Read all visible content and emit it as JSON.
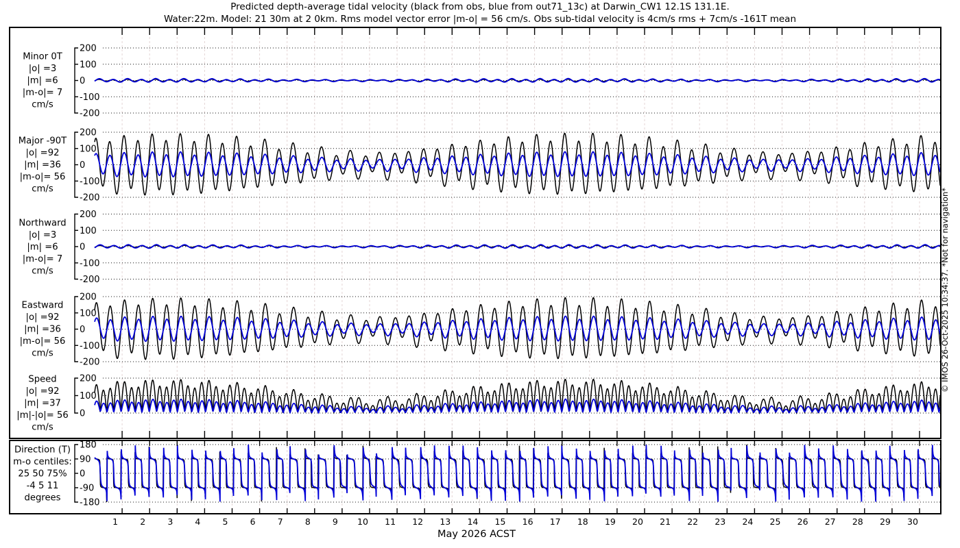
{
  "title": {
    "line1": "Predicted depth-average tidal velocity (black from obs, blue from out71_13c) at Darwin_CW1 12.1S 131.1E.",
    "line2": "Water:22m. Model: 21 30m at 2 0km. Rms model vector error |m-o| = 56 cm/s. Obs sub-tidal velocity is 4cm/s rms + 7cm/s -161T mean"
  },
  "watermark": "© IMOS 26-Oct-2025 10:34:37. *Not for navigation*",
  "chart_data": {
    "type": "line",
    "x_axis": {
      "label": "May 2026 ACST",
      "day_labels": [
        1,
        2,
        3,
        4,
        5,
        6,
        7,
        8,
        9,
        10,
        11,
        12,
        13,
        14,
        15,
        16,
        17,
        18,
        19,
        20,
        21,
        22,
        23,
        24,
        25,
        26,
        27,
        28,
        29,
        30
      ],
      "tick_days": [
        1,
        2,
        3,
        4,
        5,
        6,
        7,
        8,
        9,
        10,
        11,
        12,
        13,
        14,
        15,
        16,
        17,
        18,
        19,
        20,
        21,
        22,
        23,
        24,
        25,
        26,
        27,
        28,
        29,
        30
      ],
      "t_start": 0.0,
      "t_end": 30.75
    },
    "colors": {
      "obs": "#000000",
      "model": "#0000d8",
      "grid_h": "#111111",
      "grid_v": "#e4d5d5",
      "frame": "#000000"
    },
    "sample_dt_days": 0.01,
    "harmonic_format": "[amplitude, period_days, phase_days] ; value(t)=sum(a*cos(2*pi*(t-phase)/period))",
    "panels": [
      {
        "id": "minor",
        "kind": "harmonic",
        "label_lines": [
          "Minor 0T",
          "|o| =3",
          "|m| =6",
          "|m-o|= 7",
          "cm/s"
        ],
        "ylim": [
          -200,
          200
        ],
        "yticks": [
          200,
          100,
          0,
          -100,
          -200
        ],
        "obs_harmonics": [
          [
            4.2,
            0.5175,
            2.72
          ],
          [
            1.6,
            0.5,
            2.7
          ],
          [
            2.0,
            0.9973,
            2.3
          ]
        ],
        "model_harmonics": [
          [
            6.8,
            0.5175,
            2.74
          ],
          [
            2.4,
            0.5,
            2.71
          ],
          [
            2.6,
            0.9973,
            2.25
          ]
        ]
      },
      {
        "id": "major",
        "kind": "harmonic",
        "label_lines": [
          "Major -90T",
          "|o| =92",
          "|m| =36",
          "|m-o|= 56",
          "cm/s"
        ],
        "ylim": [
          -200,
          200
        ],
        "yticks": [
          200,
          100,
          0,
          -100,
          -200
        ],
        "obs_harmonics": [
          [
            118,
            0.5175,
            2.6
          ],
          [
            52,
            0.5,
            2.6
          ],
          [
            26,
            0.9973,
            2.2
          ]
        ],
        "model_harmonics": [
          [
            50,
            0.5175,
            2.61
          ],
          [
            20,
            0.5,
            2.61
          ],
          [
            10,
            0.9973,
            2.18
          ]
        ]
      },
      {
        "id": "northward",
        "kind": "harmonic",
        "label_lines": [
          "Northward",
          "|o| =3",
          "|m| =6",
          "|m-o|= 7",
          "cm/s"
        ],
        "ylim": [
          -200,
          200
        ],
        "yticks": [
          200,
          100,
          0,
          -100,
          -200
        ],
        "obs_harmonics": [
          [
            4.2,
            0.5175,
            2.75
          ],
          [
            1.6,
            0.5,
            2.72
          ],
          [
            2.0,
            0.9973,
            2.35
          ]
        ],
        "model_harmonics": [
          [
            6.8,
            0.5175,
            2.77
          ],
          [
            2.4,
            0.5,
            2.73
          ],
          [
            2.6,
            0.9973,
            2.28
          ]
        ]
      },
      {
        "id": "eastward",
        "kind": "harmonic",
        "label_lines": [
          "Eastward",
          "|o| =92",
          "|m| =36",
          "|m-o|= 56",
          "cm/s"
        ],
        "ylim": [
          -200,
          200
        ],
        "yticks": [
          200,
          100,
          0,
          -100,
          -200
        ],
        "obs_harmonics": [
          [
            118,
            0.5175,
            2.62
          ],
          [
            52,
            0.5,
            2.62
          ],
          [
            26,
            0.9973,
            2.22
          ]
        ],
        "model_harmonics": [
          [
            50,
            0.5175,
            2.63
          ],
          [
            20,
            0.5,
            2.63
          ],
          [
            10,
            0.9973,
            2.2
          ]
        ]
      },
      {
        "id": "speed",
        "kind": "speed",
        "east": "eastward",
        "north": "northward",
        "label_lines": [
          "Speed",
          "|o| =92",
          "|m| =37",
          "|m|-|o|= 56",
          "cm/s"
        ],
        "ylim": [
          0,
          200
        ],
        "yticks": [
          200,
          100,
          0
        ]
      },
      {
        "id": "direction",
        "kind": "direction",
        "east": "eastward",
        "north": "northward",
        "label_lines": [
          "Direction (T)",
          "m-o centiles:",
          "25  50  75%",
          "-4   5   11",
          "degrees"
        ],
        "ylim": [
          -180,
          180
        ],
        "yticks": [
          180,
          90,
          0,
          -90,
          -180
        ]
      }
    ]
  }
}
